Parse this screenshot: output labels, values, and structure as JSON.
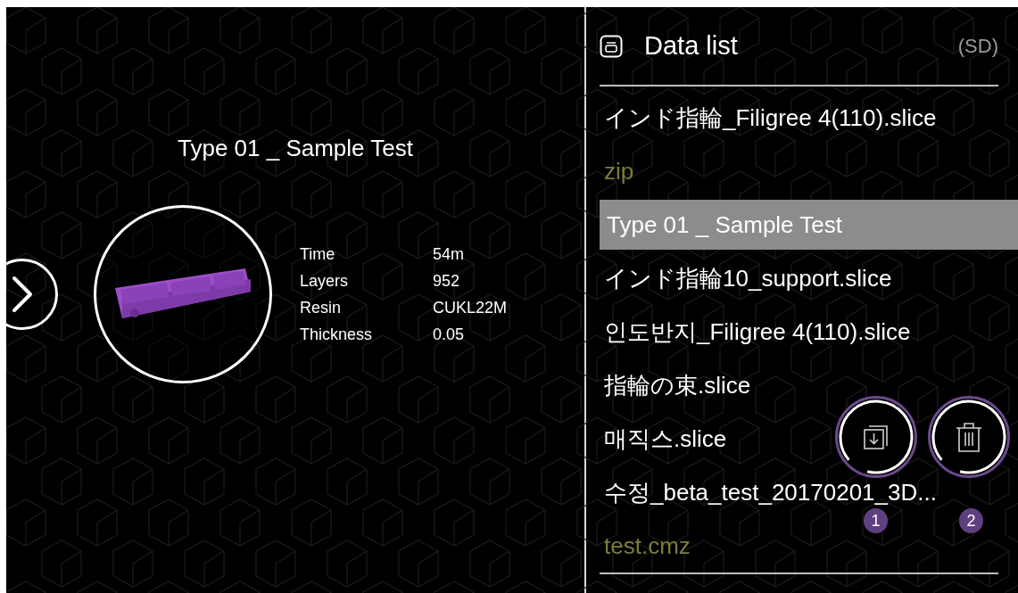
{
  "detail": {
    "title": "Type 01 _ Sample Test",
    "info": [
      {
        "label": "Time",
        "value": "54m"
      },
      {
        "label": "Layers",
        "value": "952"
      },
      {
        "label": "Resin",
        "value": "CUKL22M"
      },
      {
        "label": "Thickness",
        "value": "0.05"
      }
    ]
  },
  "data_list": {
    "title": "Data list",
    "storage": "(SD)",
    "items": [
      {
        "label": "インド指輪_Filigree 4(110).slice",
        "kind": "slice",
        "selected": false
      },
      {
        "label": "zip",
        "kind": "other",
        "selected": false
      },
      {
        "label": "Type 01 _ Sample Test",
        "kind": "slice",
        "selected": true
      },
      {
        "label": "インド指輪10_support.slice",
        "kind": "slice",
        "selected": false
      },
      {
        "label": "인도반지_Filigree 4(110).slice",
        "kind": "slice",
        "selected": false
      },
      {
        "label": "指輪の束.slice",
        "kind": "slice",
        "selected": false
      },
      {
        "label": "매직스.slice",
        "kind": "slice",
        "selected": false
      },
      {
        "label": "수정_beta_test_20170201_3D...",
        "kind": "slice",
        "selected": false
      },
      {
        "label": "test.cmz",
        "kind": "other",
        "selected": false
      }
    ]
  },
  "actions": [
    {
      "kind": "copy",
      "badge": "1"
    },
    {
      "kind": "delete",
      "badge": "2"
    }
  ]
}
